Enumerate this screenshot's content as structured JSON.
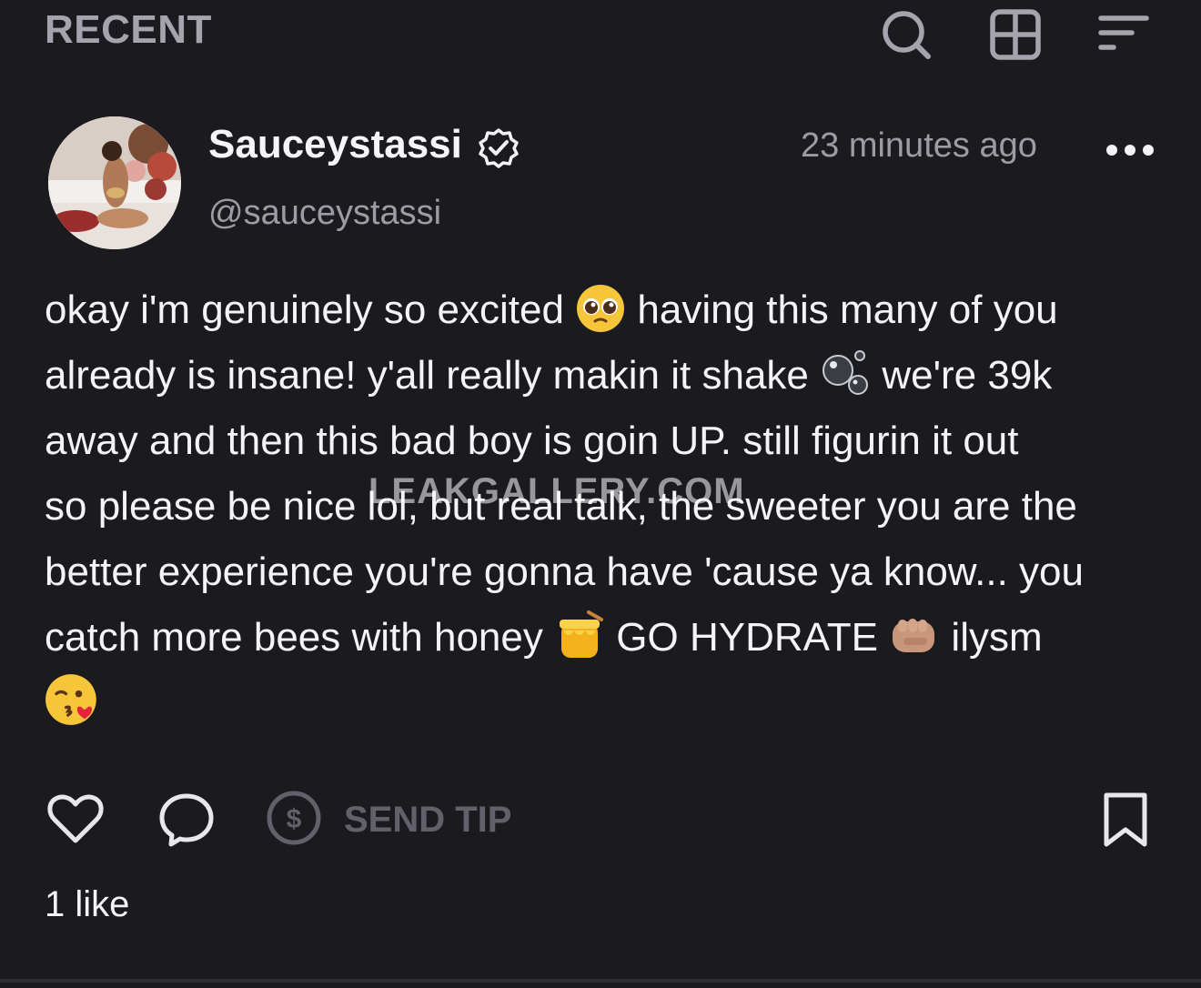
{
  "header": {
    "section_title": "RECENT",
    "icons": [
      "search-icon",
      "grid-icon",
      "filter-icon"
    ]
  },
  "post": {
    "author_name": "Sauceystassi",
    "author_handle": "@sauceystassi",
    "verified": true,
    "timestamp": "23 minutes ago",
    "text_lines": [
      {
        "parts": [
          "okay i'm genuinely so excited ",
          "pleading-face-emoji",
          " having this many of you"
        ]
      },
      {
        "parts": [
          "already is insane! y'all really makin it shake ",
          "bubbles-emoji",
          " we're 39k"
        ]
      },
      {
        "parts": [
          "away and then this bad boy is goin UP. still figurin it out"
        ]
      },
      {
        "parts": [
          "so please be nice lol, but real talk, the sweeter you are the"
        ]
      },
      {
        "parts": [
          "better experience you're gonna have 'cause ya know... you"
        ]
      },
      {
        "parts": [
          "catch more bees with honey ",
          "honey-pot-emoji",
          " GO HYDRATE ",
          "fist-emoji",
          " ilysm"
        ]
      },
      {
        "parts": [
          "kiss-emoji"
        ]
      }
    ],
    "line_1a": "okay i'm genuinely so excited ",
    "line_1b": " having this many of you",
    "line_2a": "already is insane! y'all really makin it shake ",
    "line_2b": " we're 39k",
    "line_3": "away and then this bad boy is goin UP. still figurin it out",
    "line_4": "so please be nice lol, but real talk, the sweeter you are the",
    "line_5": "better experience you're gonna have 'cause ya know... you",
    "line_6a": "catch more bees with honey ",
    "line_6b": " GO HYDRATE ",
    "line_6c": " ilysm",
    "watermark": "LEAKGALLERY.COM"
  },
  "actions": {
    "send_tip_label": "SEND TIP",
    "likes_text": "1 like",
    "icons": [
      "heart-icon",
      "comment-icon",
      "dollar-icon",
      "bookmark-icon"
    ]
  },
  "colors": {
    "background": "#1b1b1f",
    "text": "#f4f4f6",
    "muted": "#9c9ca5",
    "header_title": "#a3a4ad",
    "tip_disabled": "#60616a"
  }
}
